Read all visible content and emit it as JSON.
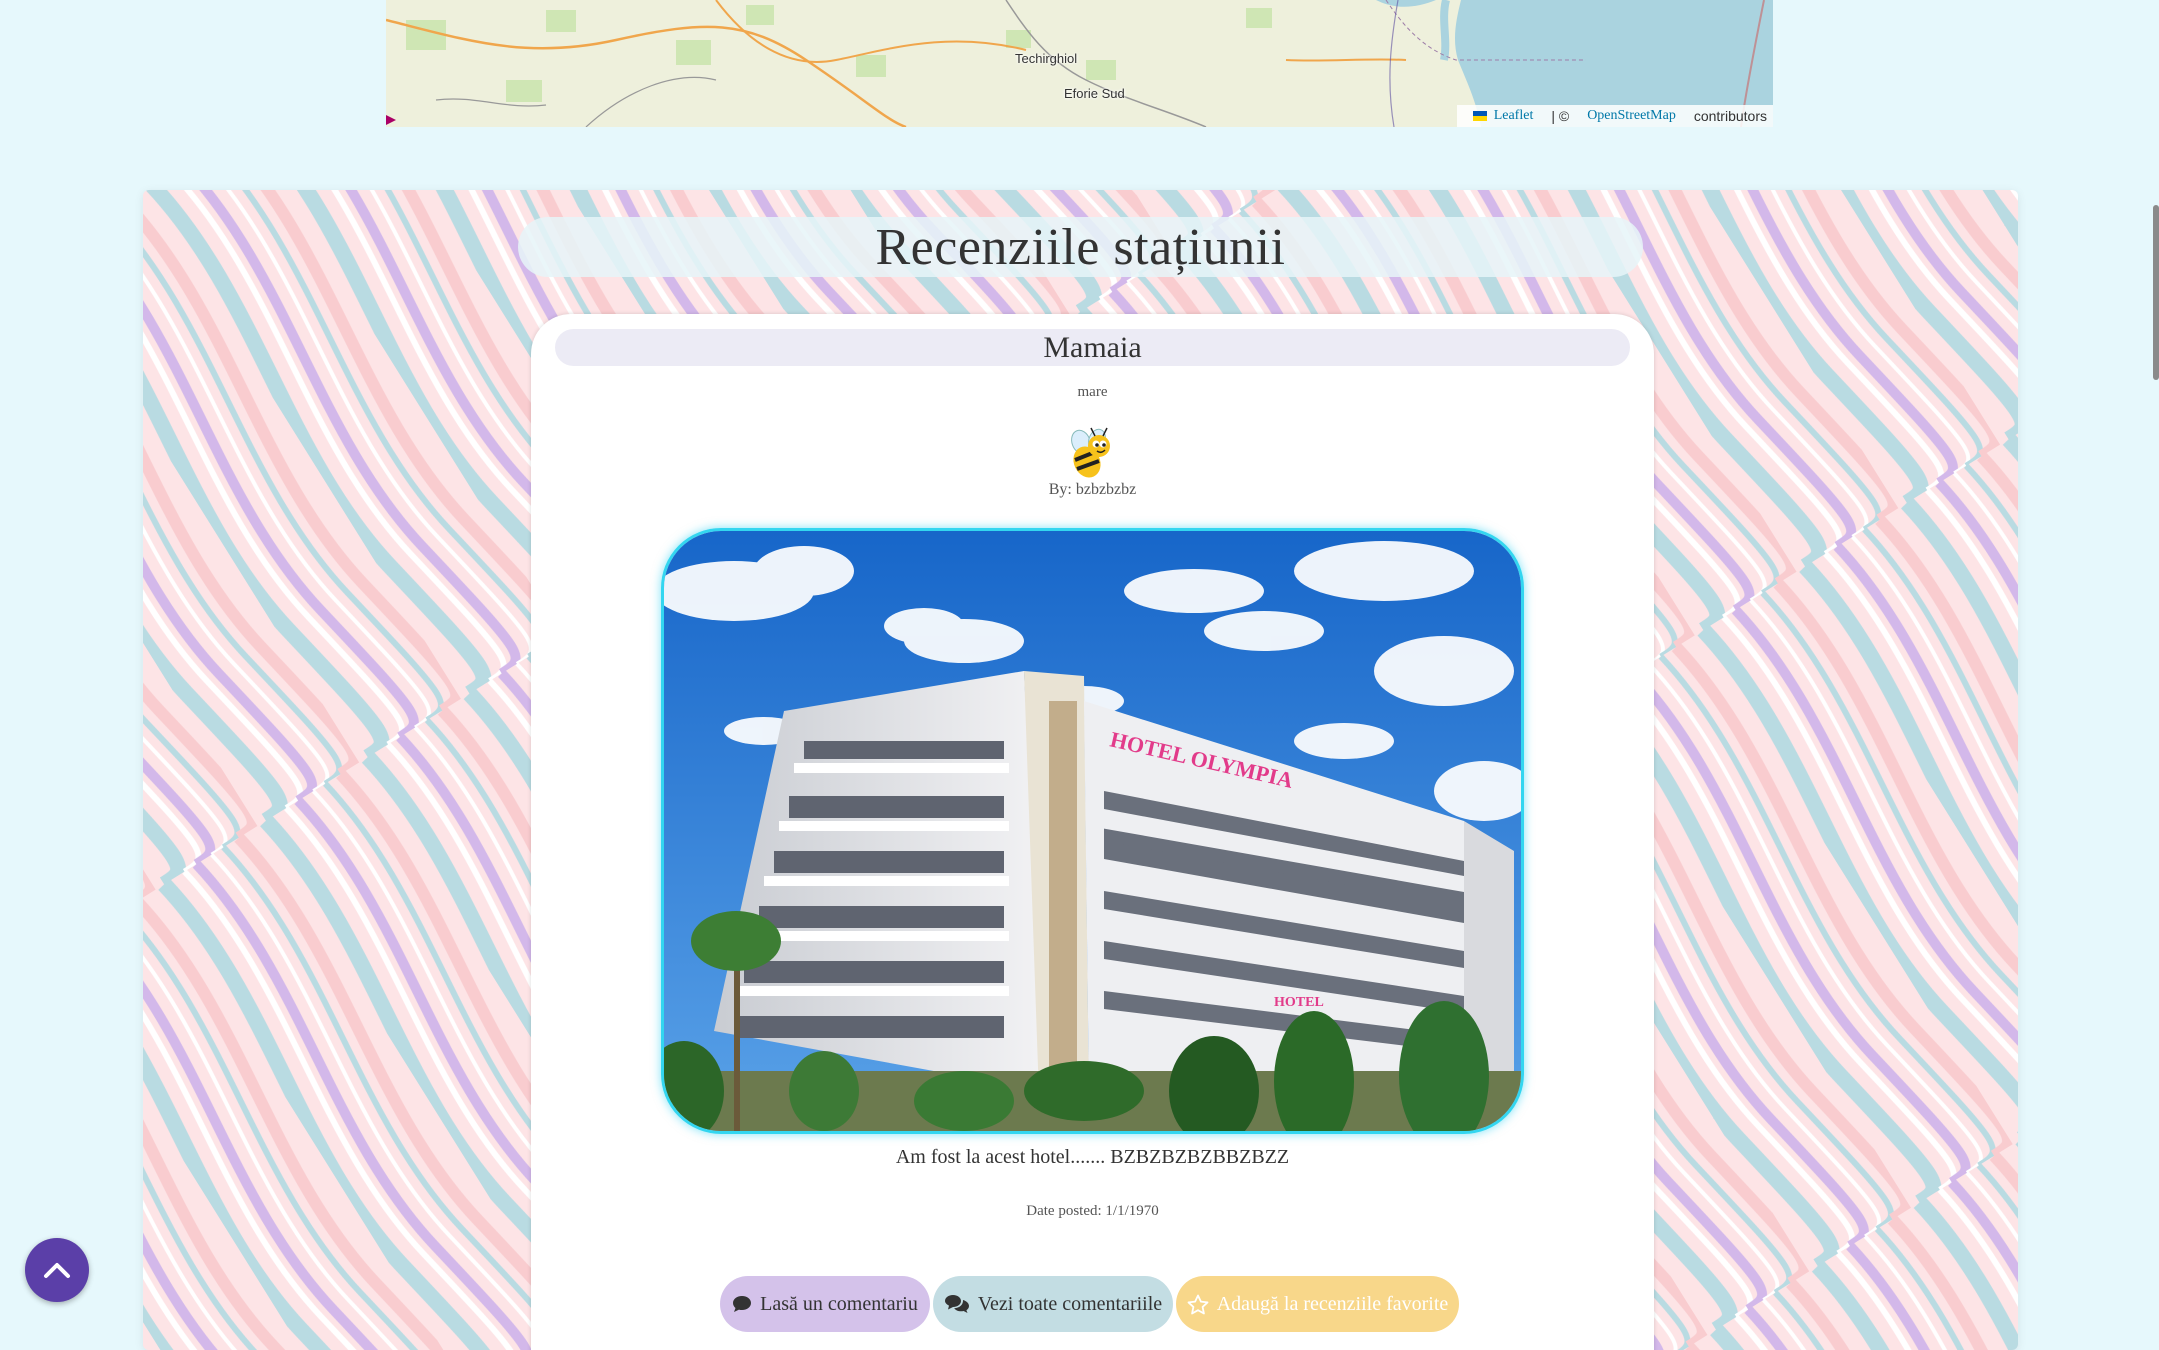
{
  "map": {
    "labels": {
      "town1": "Techirghiol",
      "town2": "Eforie Sud"
    },
    "attribution": {
      "leaflet": "Leaflet",
      "separator": "| ©",
      "osm": "OpenStreetMap",
      "contributors": "contributors"
    }
  },
  "section": {
    "title": "Recenziile stațiunii"
  },
  "review": {
    "title": "Mamaia",
    "category": "mare",
    "author": "By: bzbzbzbz",
    "text": "Am fost la acest hotel....... BZBZBZBZBBZBZZ",
    "date": "Date posted: 1/1/1970"
  },
  "buttons": {
    "comment": "Lasă un comentariu",
    "view_all": "Vezi toate comentariile",
    "favorite": "Adaugă la recenziile favorite"
  },
  "icons": {
    "scroll_top": "chevron-up-icon",
    "comment": "comment-icon",
    "comments": "comments-icon",
    "star": "star-outline-icon"
  },
  "colors": {
    "accent_purple": "#5b3fa8",
    "photo_border": "#33d6f0",
    "favorite_btn": "#f8d78a"
  }
}
